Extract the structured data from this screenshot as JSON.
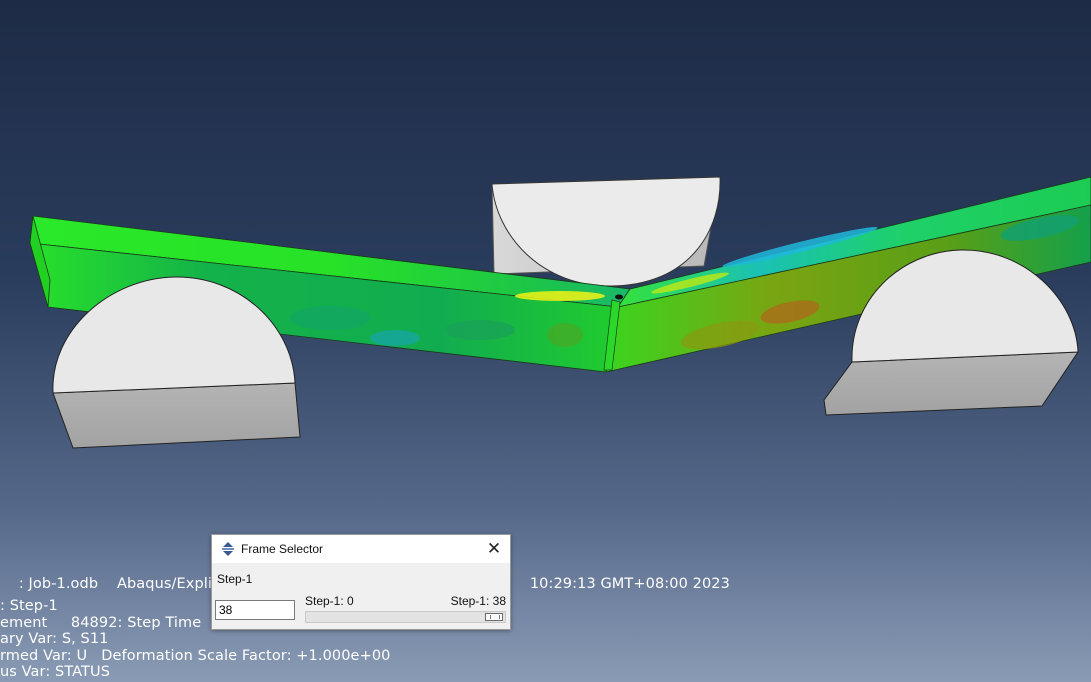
{
  "viewport": {
    "info": {
      "line1": ": Job-1.odb    Abaqus/Explici",
      "line1_tail": "10:29:13 GMT+08:00 2023",
      "line2": ": Step-1",
      "line3": "ement     84892: Step Time",
      "line4": "ary Var: S, S11",
      "line5": "rmed Var: U   Deformation Scale Factor: +1.000e+00",
      "line6": "us Var: STATUS"
    },
    "colors": {
      "background_top": "#1d2b46",
      "background_bottom": "#8a9bb5",
      "beam_primary": "#1ee31c",
      "beam_mid": "#12b452",
      "contour_high": "#8a8f10",
      "contour_low": "#19a9c6",
      "support": "#e6e6e6",
      "support_side": "#a9a9a9"
    }
  },
  "frame_selector": {
    "title": "Frame Selector",
    "icon": "frame-selector-icon",
    "close_label": "✕",
    "step_name": "Step-1",
    "frame_value": "38",
    "min_label": "Step-1: 0",
    "max_label": "Step-1: 38",
    "slider_fraction": 1.0
  }
}
